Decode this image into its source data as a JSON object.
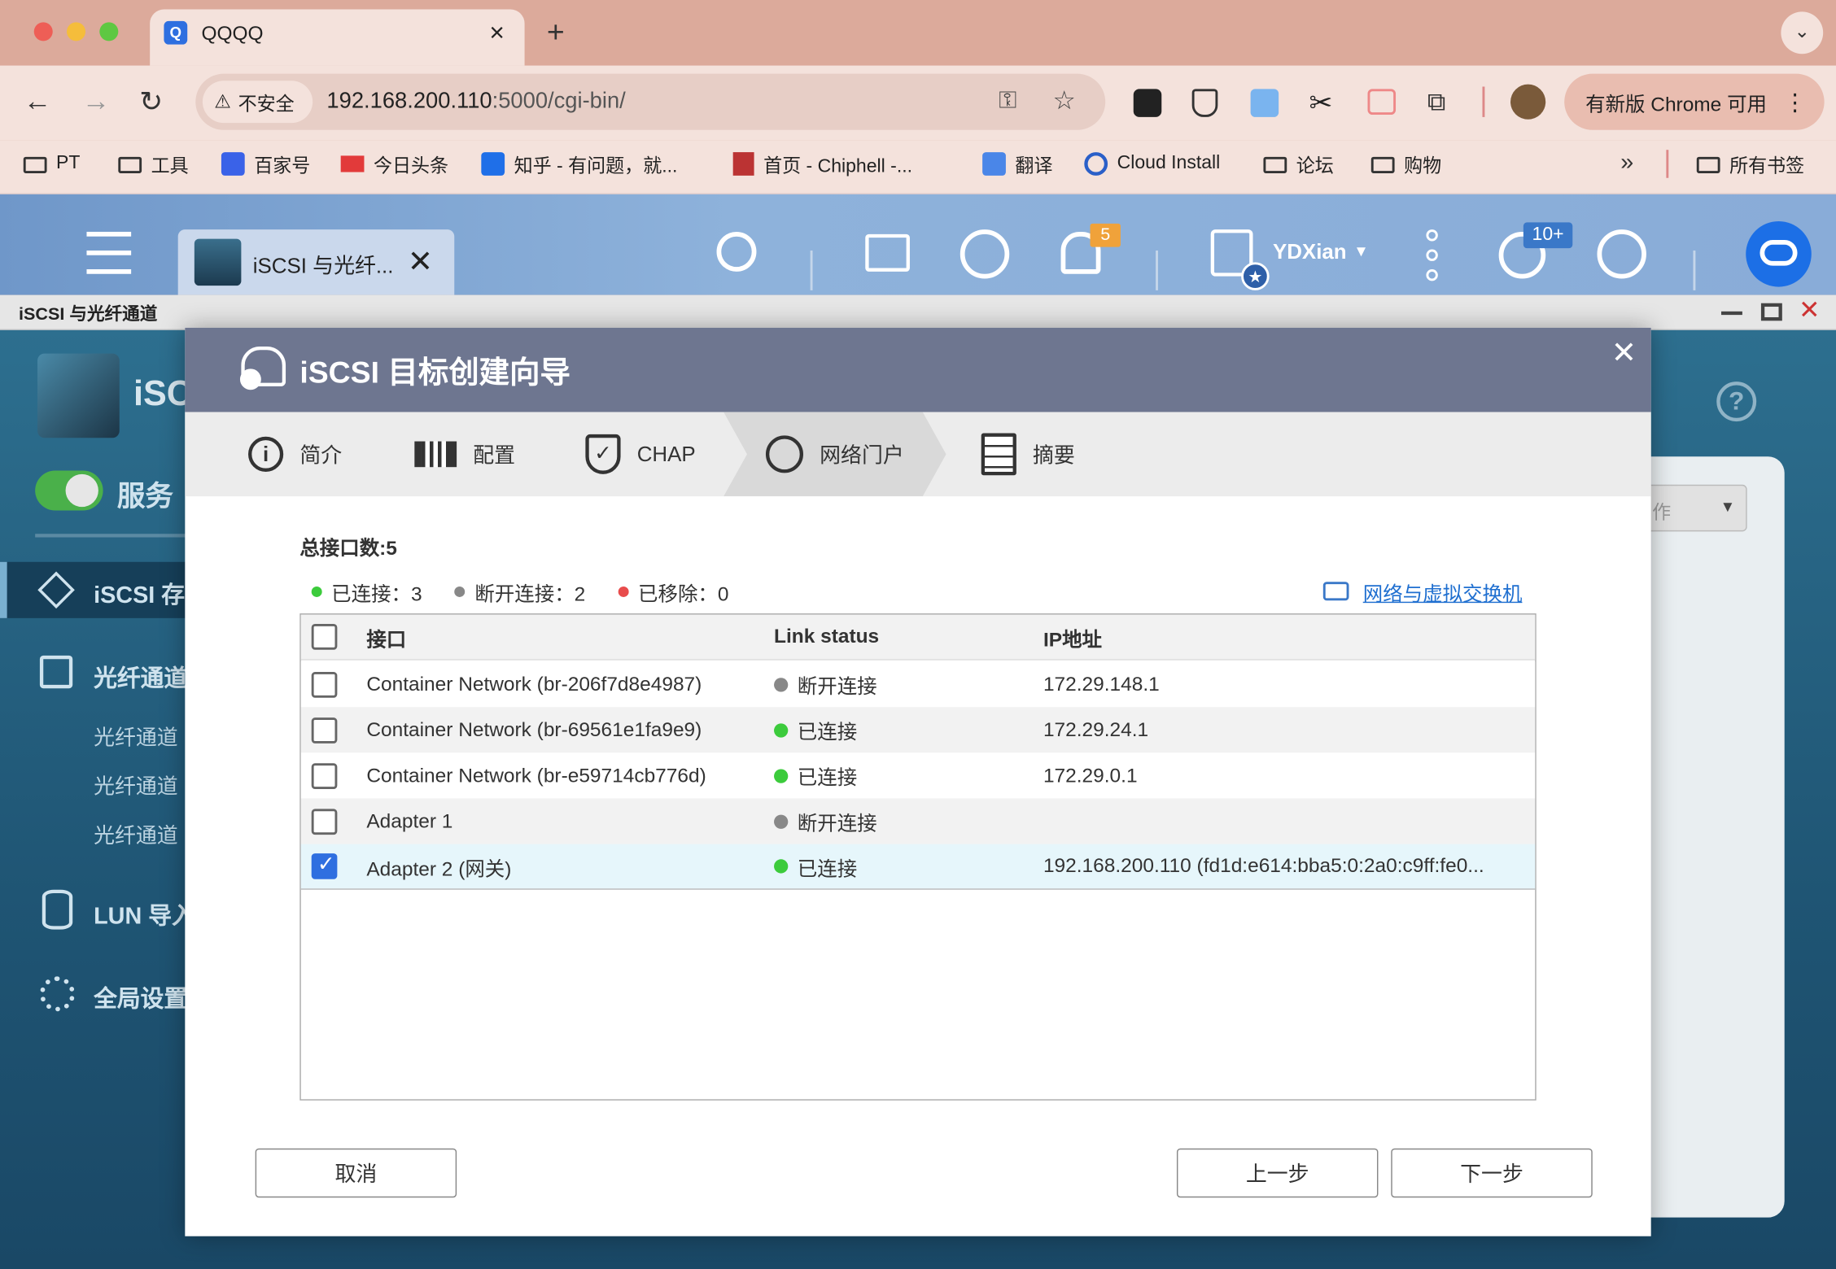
{
  "browser": {
    "tab_title": "QQQQ",
    "security_label": "不安全",
    "url_host": "192.168.200.110",
    "url_rest": ":5000/cgi-bin/",
    "update_button": "有新版 Chrome 可用",
    "bookmarks": [
      {
        "label": "PT",
        "icon": "folder-icon"
      },
      {
        "label": "工具",
        "icon": "folder-icon"
      },
      {
        "label": "百家号",
        "icon": "baijiahao-icon"
      },
      {
        "label": "今日头条",
        "icon": "toutiao-icon"
      },
      {
        "label": "知乎 - 有问题，就...",
        "icon": "zhihu-icon"
      },
      {
        "label": "首页 - Chiphell -...",
        "icon": "chiphell-icon"
      },
      {
        "label": "翻译",
        "icon": "translate-icon"
      },
      {
        "label": "Cloud Install",
        "icon": "cloud-icon"
      },
      {
        "label": "论坛",
        "icon": "folder-icon"
      },
      {
        "label": "购物",
        "icon": "folder-icon"
      }
    ],
    "all_bookmarks": "所有书签"
  },
  "nas": {
    "app_tab_label": "iSCSI 与光纤...",
    "notification_count": "5",
    "user_name": "YDXian",
    "event_count": "10+",
    "window_title": "iSCSI 与光纤通道"
  },
  "app": {
    "header_partial": "iSC",
    "service_label": "服务",
    "nav": {
      "iscsi": "iSCSI 存",
      "fc": "光纤通道",
      "fc_sub": [
        "光纤通道",
        "光纤通道",
        "光纤通道"
      ],
      "lun": "LUN 导入",
      "global": "全局设置"
    },
    "dropdown_partial": "作"
  },
  "dialog": {
    "title": "iSCSI 目标创建向导",
    "steps": [
      "简介",
      "配置",
      "CHAP",
      "网络门户",
      "摘要"
    ],
    "total_label": "总接口数:5",
    "legend": {
      "connected": "已连接：3",
      "disconnected": "断开连接：2",
      "removed": "已移除：0"
    },
    "network_link": "网络与虚拟交换机",
    "columns": [
      "接口",
      "Link status",
      "IP地址"
    ],
    "rows": [
      {
        "name": "Container Network (br-206f7d8e4987)",
        "status": "断开连接",
        "ip": "172.29.148.1",
        "checked": false
      },
      {
        "name": "Container Network (br-69561e1fa9e9)",
        "status": "已连接",
        "ip": "172.29.24.1",
        "checked": false
      },
      {
        "name": "Container Network (br-e59714cb776d)",
        "status": "已连接",
        "ip": "172.29.0.1",
        "checked": false
      },
      {
        "name": "Adapter 1",
        "status": "断开连接",
        "ip": "",
        "checked": false
      },
      {
        "name": "Adapter 2 (网关)",
        "status": "已连接",
        "ip": "192.168.200.110 (fd1d:e614:bba5:0:2a0:c9ff:fe0...",
        "checked": true
      }
    ],
    "buttons": {
      "cancel": "取消",
      "prev": "上一步",
      "next": "下一步"
    }
  },
  "colors": {
    "connected": "#3ccb3c",
    "disconnected": "#888888",
    "removed": "#e84c4c",
    "accent": "#2f6fe0"
  }
}
